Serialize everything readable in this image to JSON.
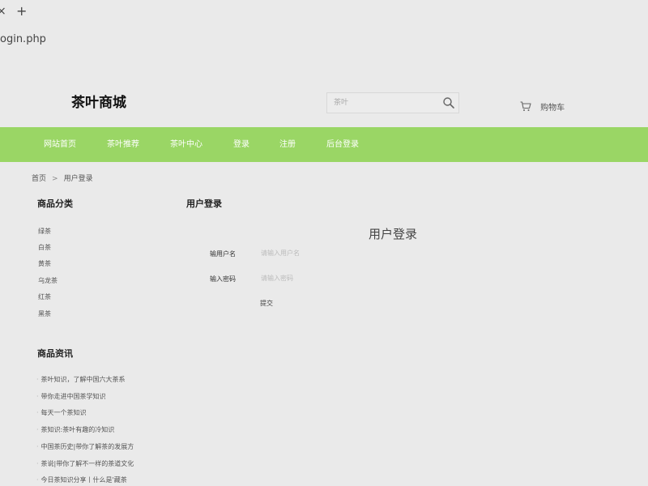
{
  "browser": {
    "close_glyph": "×",
    "new_tab_glyph": "+",
    "address": "ogin.php"
  },
  "header": {
    "logo": "茶叶商城",
    "search_placeholder": "茶叶",
    "cart_label": "购物车"
  },
  "nav": {
    "items": [
      "网站首页",
      "茶叶推荐",
      "茶叶中心",
      "登录",
      "注册",
      "后台登录"
    ],
    "background": "#9ad665"
  },
  "breadcrumb": {
    "home": "首页",
    "separator": ">",
    "current": "用户登录"
  },
  "sidebar": {
    "categories_title": "商品分类",
    "categories": [
      "绿茶",
      "白茶",
      "黄茶",
      "乌龙茶",
      "红茶",
      "黑茶"
    ],
    "news_title": "商品资讯",
    "news": [
      "茶叶知识，了解中国六大茶系",
      "带你走进中国茶学知识",
      "每天一个茶知识",
      "茶知识:茶叶有趣的冷知识",
      "中国茶历史|带你了解茶的发展方",
      "茶说|带你了解不一样的茶道文化",
      "今日茶知识分享丨什么是'藏茶"
    ]
  },
  "login": {
    "page_title": "用户登录",
    "form_heading": "用户登录",
    "username_label": "输用户名",
    "username_placeholder": "请输入用户名",
    "password_label": "输入密码",
    "password_placeholder": "请输入密码",
    "submit_label": "提交"
  }
}
